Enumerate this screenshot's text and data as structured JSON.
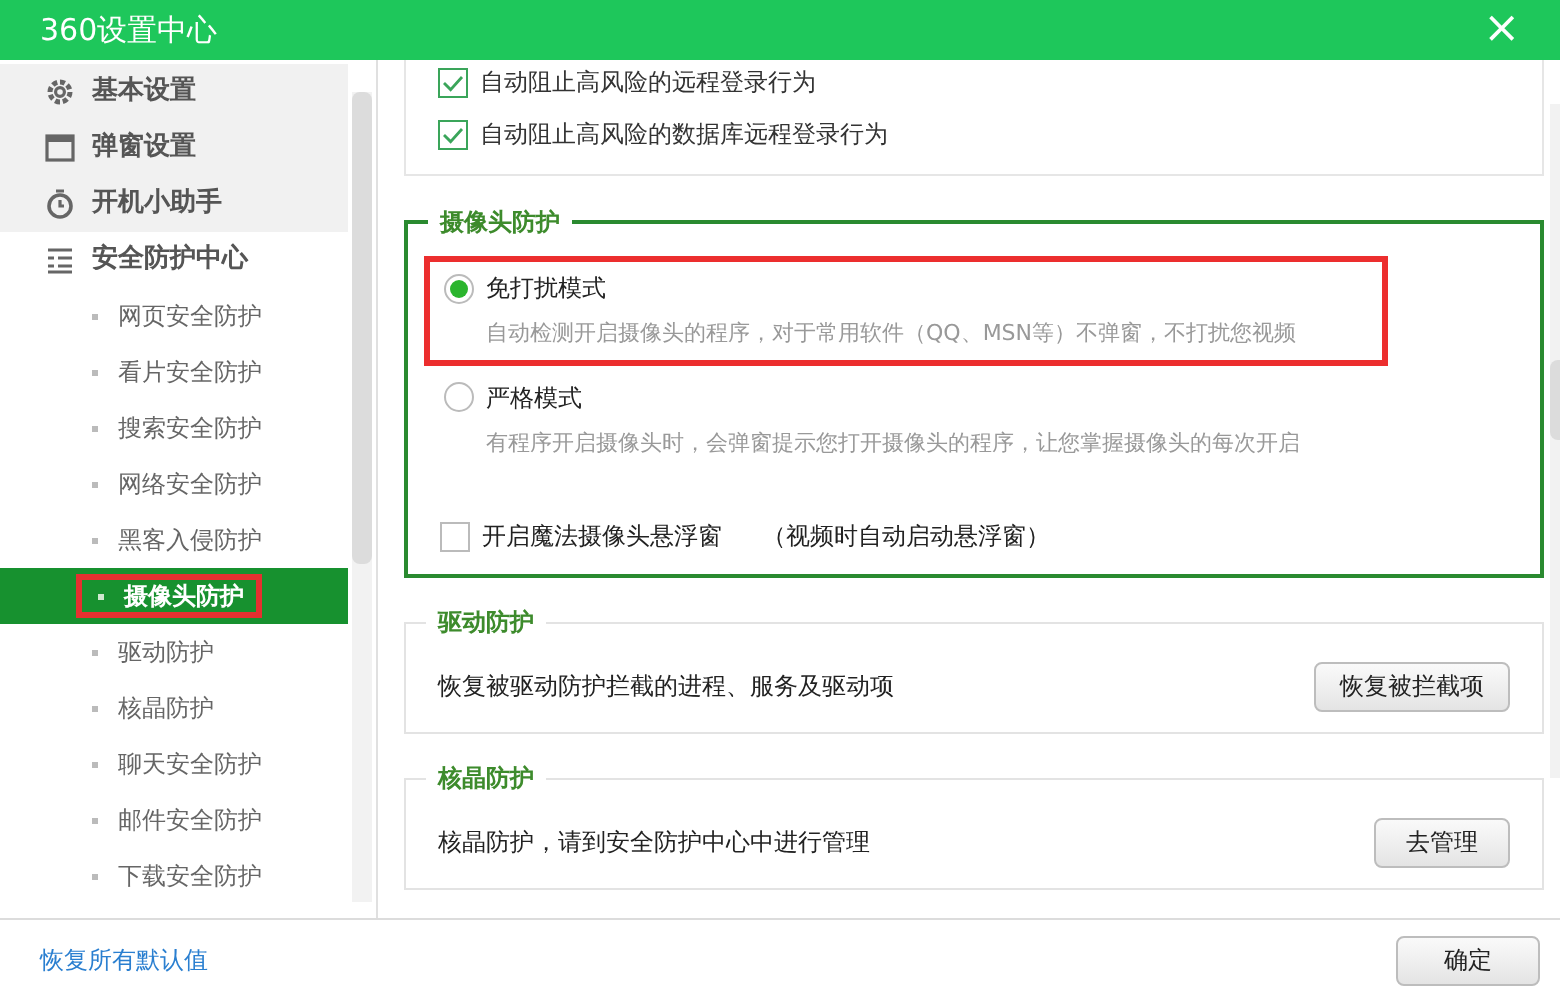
{
  "window": {
    "title": "360设置中心",
    "close": "×"
  },
  "sidebar": {
    "items": [
      {
        "label": "基本设置",
        "kind": "gear",
        "selected": false
      },
      {
        "label": "弹窗设置",
        "kind": "window",
        "selected": false
      },
      {
        "label": "开机小助手",
        "kind": "timer",
        "selected": false
      },
      {
        "label": "安全防护中心",
        "kind": "list",
        "selected": false,
        "children": [
          {
            "label": "网页安全防护",
            "selected": false,
            "highlighted": false
          },
          {
            "label": "看片安全防护",
            "selected": false,
            "highlighted": false
          },
          {
            "label": "搜索安全防护",
            "selected": false,
            "highlighted": false
          },
          {
            "label": "网络安全防护",
            "selected": false,
            "highlighted": false
          },
          {
            "label": "黑客入侵防护",
            "selected": false,
            "highlighted": false
          },
          {
            "label": "摄像头防护",
            "selected": true,
            "highlighted": true
          },
          {
            "label": "驱动防护",
            "selected": false,
            "highlighted": false
          },
          {
            "label": "核晶防护",
            "selected": false,
            "highlighted": false
          },
          {
            "label": "聊天安全防护",
            "selected": false,
            "highlighted": false
          },
          {
            "label": "邮件安全防护",
            "selected": false,
            "highlighted": false
          },
          {
            "label": "下载安全防护",
            "selected": false,
            "highlighted": false
          }
        ]
      }
    ]
  },
  "sections": [
    {
      "kind": "checks",
      "items": [
        {
          "label": "自动阻止高风险的远程登录行为",
          "checked": true
        },
        {
          "label": "自动阻止高风险的数据库远程登录行为",
          "checked": true
        }
      ]
    },
    {
      "kind": "camera",
      "title": "摄像头防护",
      "options": [
        {
          "label": "免打扰模式",
          "description": "自动检测开启摄像头的程序，对于常用软件（QQ、MSN等）不弹窗，不打扰您视频",
          "selected": true,
          "highlighted": true
        },
        {
          "label": "严格模式",
          "description": "有程序开启摄像头时，会弹窗提示您打开摄像头的程序，让您掌握摄像头的每次开启",
          "selected": false,
          "highlighted": false
        }
      ],
      "checkbox": {
        "label": "开启魔法摄像头悬浮窗",
        "note": "（视频时自动启动悬浮窗）",
        "checked": false
      }
    },
    {
      "kind": "action",
      "title": "驱动防护",
      "text": "恢复被驱动防护拦截的进程、服务及驱动项",
      "button": "恢复被拦截项"
    },
    {
      "kind": "action",
      "title": "核晶防护",
      "text": "核晶防护，请到安全防护中心中进行管理",
      "button": "去管理"
    }
  ],
  "footer": {
    "link": "恢复所有默认值",
    "button": "确定"
  }
}
